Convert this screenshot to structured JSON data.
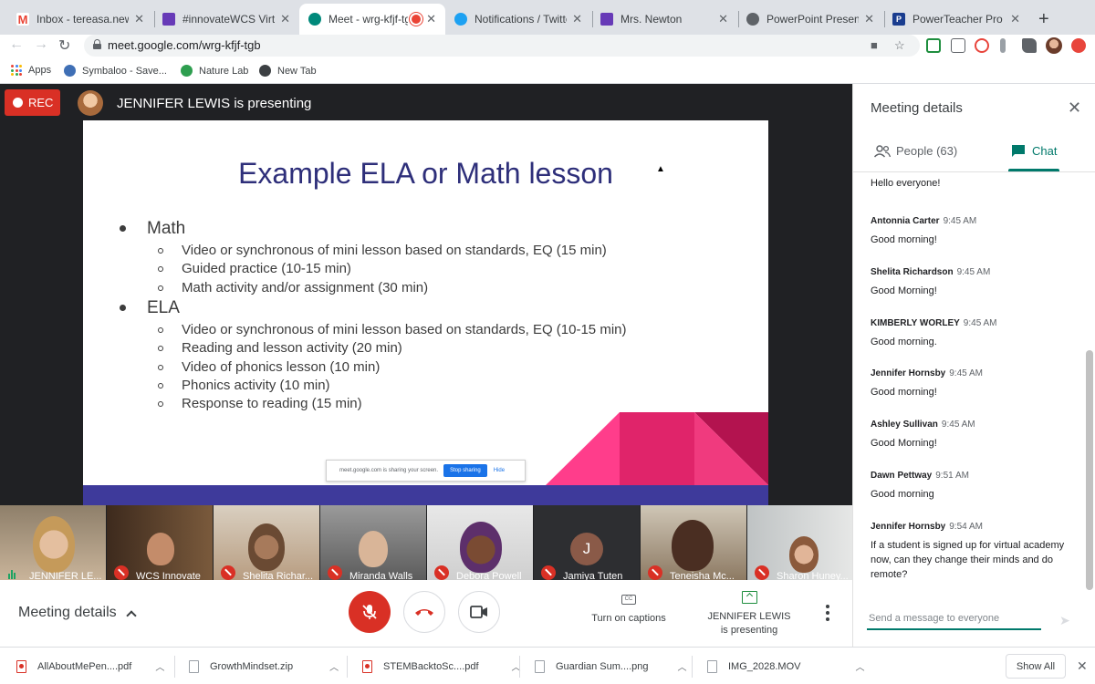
{
  "browser": {
    "tabs": [
      {
        "label": "Inbox - tereasa.newton",
        "icon": "gmail-icon",
        "color": "#ea4335"
      },
      {
        "label": "#innovateWCS Virtual",
        "icon": "forms-icon",
        "color": "#673ab7"
      },
      {
        "label": "Meet - wrg-kfjf-tg",
        "icon": "meet-icon",
        "color": "#00897b",
        "recording": true
      },
      {
        "label": "Notifications / Twitter",
        "icon": "twitter-icon",
        "color": "#1da1f2"
      },
      {
        "label": "Mrs. Newton",
        "icon": "forms-icon",
        "color": "#673ab7"
      },
      {
        "label": "PowerPoint Presentatio",
        "icon": "globe-icon",
        "color": "#5f6368"
      },
      {
        "label": "PowerTeacher Pro",
        "icon": "powerteacher-icon",
        "color": "#1a3d8f"
      }
    ],
    "close_glyph": "✕",
    "new_tab_glyph": "+",
    "url": "meet.google.com/wrg-kfjf-tgb",
    "bookmarks": [
      {
        "label": "Apps",
        "icon": "apps-grid-icon"
      },
      {
        "label": "Symbaloo - Save...",
        "icon": "symbaloo-icon",
        "color": "#3f6fb5"
      },
      {
        "label": "Nature Lab",
        "icon": "nature-lab-icon",
        "color": "#2e9e4f"
      },
      {
        "label": "New Tab",
        "icon": "globe-icon",
        "color": "#3c4043"
      }
    ]
  },
  "meet": {
    "rec_label": "REC",
    "presenting_text": "JENNIFER LEWIS is presenting",
    "slide": {
      "title": "Example ELA or Math lesson",
      "sections": [
        {
          "heading": "Math",
          "items": [
            "Video or synchronous of mini lesson based on standards, EQ (15 min)",
            "Guided practice (10-15 min)",
            "Math activity and/or assignment (30 min)"
          ]
        },
        {
          "heading": "ELA",
          "items": [
            "Video or synchronous of mini lesson based on standards, EQ (10-15 min)",
            "Reading and lesson activity (20 min)",
            "Video of phonics lesson (10 min)",
            "Phonics activity (10 min)",
            "Response to reading (15 min)"
          ]
        }
      ],
      "share_notice": "meet.google.com is sharing your screen.",
      "stop_sharing": "Stop sharing",
      "hide": "Hide",
      "accent_colors": [
        "#3e3a9b",
        "#ff3d8b",
        "#e0246a",
        "#b3134f"
      ]
    },
    "participants": [
      {
        "name": "JENNIFER LE...",
        "speaking": true
      },
      {
        "name": "WCS Innovate",
        "muted": true
      },
      {
        "name": "Shelita Richar...",
        "muted": true
      },
      {
        "name": "Miranda Walls",
        "muted": true
      },
      {
        "name": "Debora Powell",
        "muted": true
      },
      {
        "name": "Jamiya Tuten",
        "muted": true,
        "initial": "J"
      },
      {
        "name": "Teneisha Mc...",
        "muted": true
      },
      {
        "name": "Sharon Huney...",
        "muted": true
      }
    ],
    "controls": {
      "meeting_details": "Meeting details",
      "captions": "Turn on captions",
      "cc_glyph": "CC",
      "presenting_line1": "JENNIFER LEWIS",
      "presenting_line2": "is presenting"
    }
  },
  "panel": {
    "title": "Meeting details",
    "people_tab": "People (63)",
    "chat_tab": "Chat",
    "messages": [
      {
        "sender": "",
        "time": "",
        "text": "Hello everyone!"
      },
      {
        "sender": "Antonnia Carter",
        "time": "9:45 AM",
        "text": "Good morning!"
      },
      {
        "sender": "Shelita Richardson",
        "time": "9:45 AM",
        "text": "Good Morning!"
      },
      {
        "sender": "KIMBERLY WORLEY",
        "time": "9:45 AM",
        "text": "Good morning."
      },
      {
        "sender": "Jennifer Hornsby",
        "time": "9:45 AM",
        "text": "Good morning!"
      },
      {
        "sender": "Ashley Sullivan",
        "time": "9:45 AM",
        "text": "Good Morning!"
      },
      {
        "sender": "Dawn Pettway",
        "time": "9:51 AM",
        "text": "Good morning"
      },
      {
        "sender": "Jennifer Hornsby",
        "time": "9:54 AM",
        "text": "If a student is signed up for virtual academy now, can they change their minds and do remote?"
      }
    ],
    "input_placeholder": "Send a message to everyone"
  },
  "downloads": {
    "items": [
      {
        "name": "AllAboutMePen....pdf",
        "type": "pdf"
      },
      {
        "name": "GrowthMindset.zip",
        "type": "zip"
      },
      {
        "name": "STEMBacktoSc....pdf",
        "type": "pdf"
      },
      {
        "name": "Guardian Sum....png",
        "type": "png"
      },
      {
        "name": "IMG_2028.MOV",
        "type": "mov"
      }
    ],
    "show_all": "Show All"
  }
}
